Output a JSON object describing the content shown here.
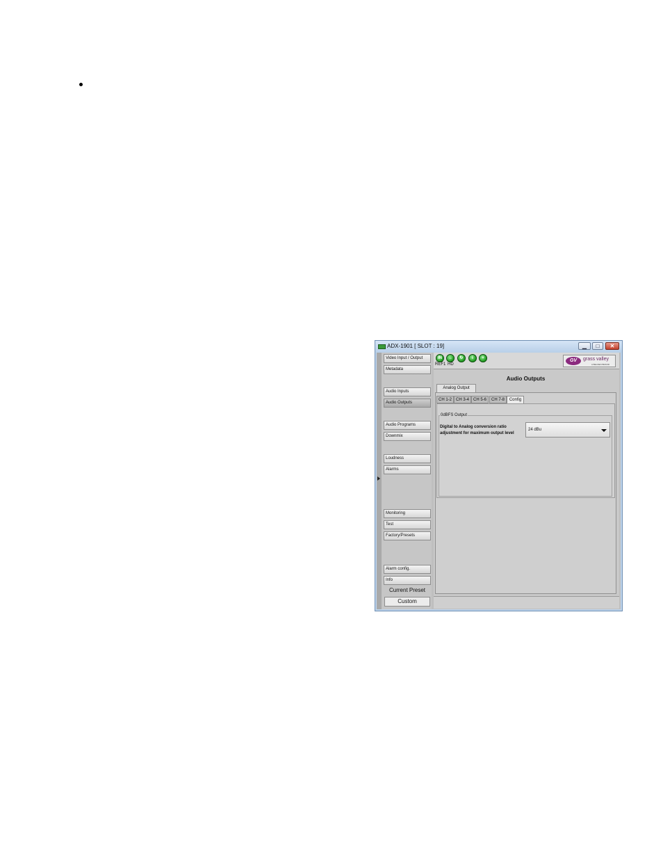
{
  "window": {
    "title": "ADX-1901 [ SLOT : 19]",
    "min_glyph": "▁",
    "max_glyph": "□",
    "close_glyph": "✕"
  },
  "status_icons": [
    {
      "name": "ref-status-icon",
      "label": "REF1",
      "glyph": "IN"
    },
    {
      "name": "hd-status-icon",
      "label": "HD",
      "glyph": "→"
    },
    {
      "name": "audio-status-icon",
      "label": "",
      "glyph": "↻"
    },
    {
      "name": "info-status-icon",
      "label": "",
      "glyph": "i"
    },
    {
      "name": "add-status-icon",
      "label": "",
      "glyph": "+"
    }
  ],
  "logo": {
    "text": "grass valley",
    "sub": "A BELDEN BRAND",
    "mark": "GV"
  },
  "sidebar": {
    "items": [
      {
        "label": "Video Input / Output",
        "active": false
      },
      {
        "label": "Metadata",
        "active": false
      },
      {
        "label": "Audio Inputs",
        "active": false
      },
      {
        "label": "Audio Outputs",
        "active": true
      },
      {
        "label": "Audio Programs",
        "active": false
      },
      {
        "label": "Downmix",
        "active": false
      },
      {
        "label": "Loudness",
        "active": false
      },
      {
        "label": "Alarms",
        "active": false
      },
      {
        "label": "Monitoring",
        "active": false
      },
      {
        "label": "Test",
        "active": false
      },
      {
        "label": "Factory/Presets",
        "active": false
      },
      {
        "label": "Alarm config.",
        "active": false
      },
      {
        "label": "Info",
        "active": false
      }
    ],
    "preset_label": "Current Preset",
    "preset_value": "Custom"
  },
  "main": {
    "title": "Audio Outputs",
    "top_tab": "Analog Output",
    "subtabs": [
      "CH 1-2",
      "CH 3-4",
      "CH 5-6",
      "CH 7-8",
      "Config"
    ],
    "active_subtab": "Config",
    "group_label": "0dBFS Output",
    "field_label": "Digital to Analog conversion ratio adjustment for maximum output level",
    "field_value": "24 dBu"
  }
}
